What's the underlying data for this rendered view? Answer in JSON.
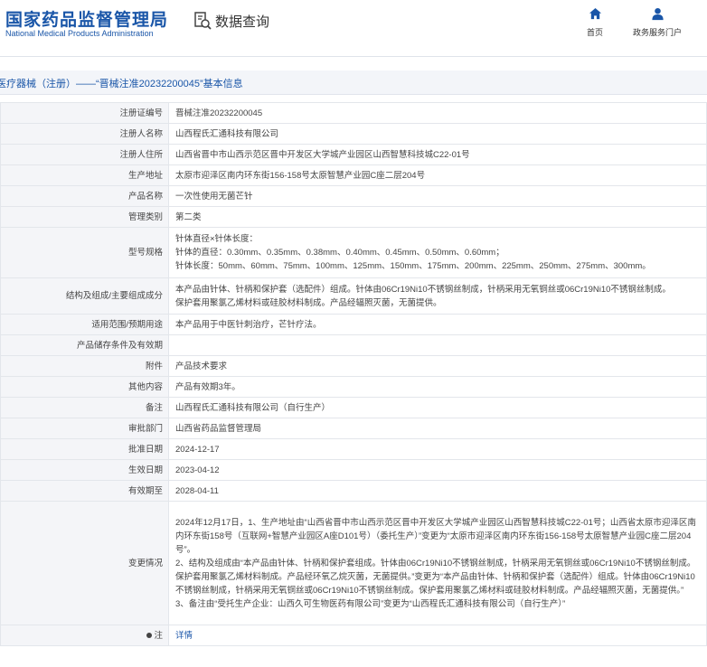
{
  "header": {
    "logo_cn": "国家药品监督管理局",
    "logo_en": "National Medical Products Administration",
    "title": "数据查询",
    "nav_home": "首页",
    "nav_portal": "政务服务门户"
  },
  "breadcrumb": "医疗器械（注册）——“晋械注准20232200045”基本信息",
  "rows": {
    "r1": {
      "label": "注册证编号",
      "value": "晋械注准20232200045"
    },
    "r2": {
      "label": "注册人名称",
      "value": "山西程氏汇通科技有限公司"
    },
    "r3": {
      "label": "注册人住所",
      "value": "山西省晋中市山西示范区晋中开发区大学城产业园区山西智慧科技城C22-01号"
    },
    "r4": {
      "label": "生产地址",
      "value": "太原市迎泽区南内环东街156-158号太原智慧产业园C座二层204号"
    },
    "r5": {
      "label": "产品名称",
      "value": "一次性使用无菌芒针"
    },
    "r6": {
      "label": "管理类别",
      "value": "第二类"
    },
    "r7": {
      "label": "型号规格",
      "line1": "针体直径×针体长度：",
      "line2": "针体的直径：0.30mm、0.35mm、0.38mm、0.40mm、0.45mm、0.50mm、0.60mm；",
      "line3": "针体长度：50mm、60mm、75mm、100mm、125mm、150mm、175mm、200mm、225mm、250mm、275mm、300mm。"
    },
    "r8": {
      "label": "结构及组成/主要组成成分",
      "line1": "本产品由针体、针柄和保护套（选配件）组成。针体由06Cr19Ni10不锈钢丝制成，针柄采用无氧铜丝或06Cr19Ni10不锈钢丝制成。",
      "line2": "保护套用聚氯乙烯材料或硅胶材料制成。产品经辐照灭菌，无菌提供。"
    },
    "r9": {
      "label": "适用范围/预期用途",
      "value": "本产品用于中医针刺治疗，芒针疗法。"
    },
    "r10": {
      "label": "产品储存条件及有效期",
      "value": ""
    },
    "r11": {
      "label": "附件",
      "value": "产品技术要求"
    },
    "r12": {
      "label": "其他内容",
      "value": "产品有效期3年。"
    },
    "r13": {
      "label": "备注",
      "value": "山西程氏汇通科技有限公司（自行生产）"
    },
    "r14": {
      "label": "审批部门",
      "value": "山西省药品监督管理局"
    },
    "r15": {
      "label": "批准日期",
      "value": "2024-12-17"
    },
    "r16": {
      "label": "生效日期",
      "value": "2023-04-12"
    },
    "r17": {
      "label": "有效期至",
      "value": "2028-04-11"
    },
    "r18": {
      "label": "变更情况",
      "value": "2024年12月17日，1、生产地址由“山西省晋中市山西示范区晋中开发区大学城产业园区山西智慧科技城C22-01号；山西省太原市迎泽区南内环东街158号（互联网+智慧产业园区A座D101号）（委托生产）”变更为“太原市迎泽区南内环东街156-158号太原智慧产业园C座二层204号”。\n2、结构及组成由“本产品由针体、针柄和保护套组成。针体由06Cr19Ni10不锈钢丝制成，针柄采用无氧铜丝或06Cr19Ni10不锈钢丝制成。保护套用聚氯乙烯材料制成。产品经环氧乙烷灭菌，无菌提供。”变更为“本产品由针体、针柄和保护套（选配件）组成。针体由06Cr19Ni10不锈钢丝制成，针柄采用无氧铜丝或06Cr19Ni10不锈钢丝制成。保护套用聚氯乙烯材料或硅胶材料制成。产品经辐照灭菌，无菌提供。”\n3、备注由“受托生产企业：山西久可生物医药有限公司”变更为“山西程氏汇通科技有限公司（自行生产）”"
    },
    "r19": {
      "label": "注",
      "link": "详情"
    }
  },
  "colors": {
    "brand_blue": "#1a56a8",
    "label_bg": "#f4f5f8",
    "border": "#e3e6eb"
  }
}
